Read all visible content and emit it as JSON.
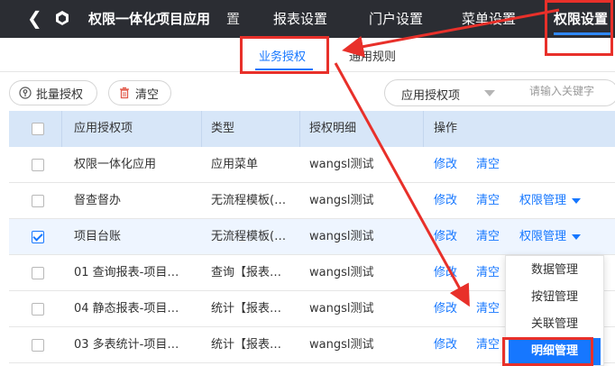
{
  "app": {
    "title": "权限一体化项目应用",
    "cut_tab": "置",
    "nav_tabs": [
      "报表设置",
      "门户设置",
      "菜单设置",
      "权限设置"
    ],
    "active_tab": "权限设置"
  },
  "subtabs": [
    "业务授权",
    "通用规则"
  ],
  "toolbar": {
    "batch_auth": "批量授权",
    "clear": "清空"
  },
  "search": {
    "select_value": "应用授权项",
    "placeholder": "请输入关键字"
  },
  "table": {
    "headers": [
      "应用授权项",
      "类型",
      "授权明细",
      "操作"
    ],
    "rows": [
      {
        "item": "权限一体化应用",
        "type": "应用菜单",
        "detail": "wangsl测试",
        "checked": false,
        "has_manage": false
      },
      {
        "item": "督查督办",
        "type": "无流程模板(…",
        "detail": "wangsl测试",
        "checked": false,
        "has_manage": true
      },
      {
        "item": "项目台账",
        "type": "无流程模板(…",
        "detail": "wangsl测试",
        "checked": true,
        "has_manage": true
      },
      {
        "item": "01 查询报表-项目…",
        "type": "查询【报表…",
        "detail": "wangsl测试",
        "checked": false,
        "has_manage": false
      },
      {
        "item": "04 静态报表-项目…",
        "type": "统计【报表…",
        "detail": "wangsl测试",
        "checked": false,
        "has_manage": false
      },
      {
        "item": "03 多表统计-项目…",
        "type": "统计【报表…",
        "detail": "wangsl测试",
        "checked": false,
        "has_manage": false
      }
    ],
    "actions": {
      "edit": "修改",
      "clear": "清空",
      "manage": "权限管理"
    }
  },
  "dropdown": {
    "items": [
      "数据管理",
      "按钮管理",
      "关联管理",
      "明细管理"
    ],
    "highlighted": "明细管理"
  },
  "colors": {
    "topbar": "#2b2d33",
    "accent": "#1677ff",
    "header_bg": "#d7e6f8",
    "annotation": "#e8302a"
  }
}
